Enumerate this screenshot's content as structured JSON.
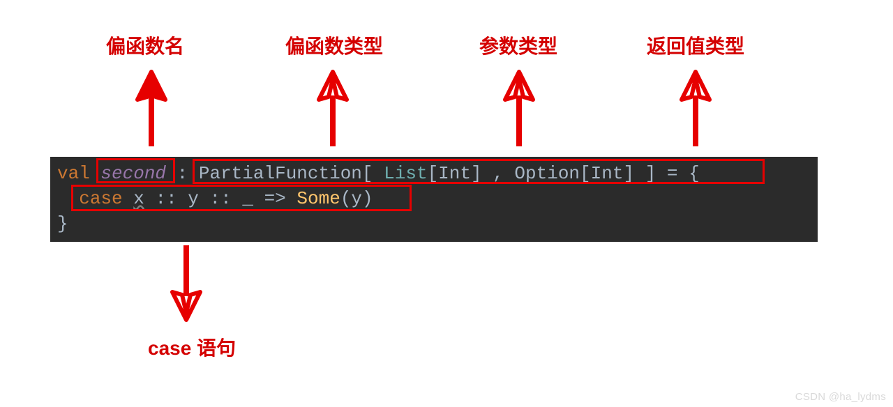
{
  "labels": {
    "name": "偏函数名",
    "type": "偏函数类型",
    "param": "参数类型",
    "ret": "返回值类型",
    "case": "case 语句"
  },
  "code": {
    "kw_val": "val",
    "sp1": " ",
    "name": "second",
    "sp2": " ",
    "colon": ":",
    "sp3": " ",
    "pf": "PartialFunction",
    "lb1": "[",
    "sp4": " ",
    "list": "List",
    "lb2": "[",
    "int1": "Int",
    "rb2": "]",
    "sp5": " ",
    "comma": ",",
    "sp6": " ",
    "option": "Option",
    "lb3": "[",
    "int2": "Int",
    "rb3": "]",
    "sp7": " ",
    "rb1": "]",
    "sp8": " ",
    "eq": "=",
    "sp9": " ",
    "lbrace": "{",
    "indent": "  ",
    "kw_case": "case",
    "sp10": " ",
    "x": "x",
    "sp11": " ",
    "cons1": "::",
    "sp12": " ",
    "y": "y",
    "sp13": " ",
    "cons2": "::",
    "sp14": " ",
    "under": "_",
    "sp15": " ",
    "arrow": "=>",
    "sp16": " ",
    "some": "Some",
    "lp": "(",
    "y2": "y",
    "rp": ")",
    "rbrace": "}"
  },
  "watermark": "CSDN @ha_lydms"
}
